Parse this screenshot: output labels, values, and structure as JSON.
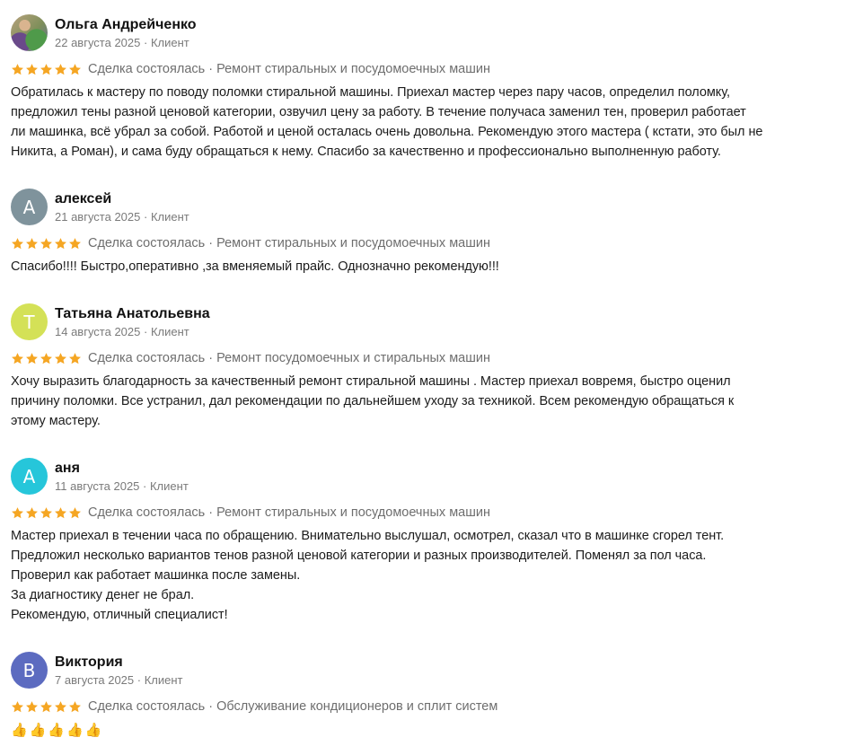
{
  "colors": {
    "star": "#f5a623",
    "avatar_2": "#7f939c",
    "avatar_3": "#d4e157",
    "avatar_4": "#26c6da",
    "avatar_5": "#5c6bc0"
  },
  "reviews": [
    {
      "name": "Ольга Андрейченко",
      "date": "22 августа 2025",
      "role": "Клиент",
      "avatar_type": "photo",
      "avatar_letter": "",
      "rating": 5,
      "status": "Сделка состоялась",
      "service": "Ремонт стиральных и посудомоечных машин",
      "text": "Обратилась к мастеру по поводу поломки стиральной машины. Приехал мастер через пару часов, определил поломку,\nпредложил тены разной ценовой категории, озвучил цену за работу. В течение получаса заменил тен, проверил работает\nли машинка, всё убрал за собой. Работой и ценой осталась очень довольна. Рекомендую этого мастера ( кстати, это был не\nНикита, а Роман), и сама буду обращаться к нему. Спасибо за качественно и профессионально выполненную работу."
    },
    {
      "name": "алексей",
      "date": "21 августа 2025",
      "role": "Клиент",
      "avatar_type": "letter",
      "avatar_letter": "А",
      "rating": 5,
      "status": "Сделка состоялась",
      "service": "Ремонт стиральных и посудомоечных машин",
      "text": "Спасибо!!!! Быстро,оперативно ,за вменяемый прайс. Однозначно рекомендую!!!"
    },
    {
      "name": "Татьяна Анатольевна",
      "date": "14 августа 2025",
      "role": "Клиент",
      "avatar_type": "letter",
      "avatar_letter": "Т",
      "rating": 5,
      "status": "Сделка состоялась",
      "service": "Ремонт посудомоечных и стиральных машин",
      "text": "Хочу выразить благодарность за качественный ремонт стиральной машины . Мастер приехал вовремя, быстро оценил\nпричину поломки. Все устранил, дал рекомендации по дальнейшем уходу за техникой. Всем рекомендую обращаться к\nэтому мастеру."
    },
    {
      "name": "аня",
      "date": "11 августа 2025",
      "role": "Клиент",
      "avatar_type": "letter",
      "avatar_letter": "А",
      "rating": 5,
      "status": "Сделка состоялась",
      "service": "Ремонт стиральных и посудомоечных машин",
      "text": "Мастер приехал в течении часа по обращению. Внимательно выслушал, осмотрел, сказал что в машинке сгорел тент.\nПредложил несколько вариантов тенов разной ценовой категории и разных производителей. Поменял за пол часа.\nПроверил как работает машинка после замены.\nЗа диагностику денег не брал.\nРекомендую, отличный специалист!"
    },
    {
      "name": "Виктория",
      "date": "7 августа 2025",
      "role": "Клиент",
      "avatar_type": "letter",
      "avatar_letter": "В",
      "rating": 5,
      "status": "Сделка состоялась",
      "service": "Обслуживание кондиционеров и сплит систем",
      "text": "👍👍👍👍👍"
    }
  ]
}
